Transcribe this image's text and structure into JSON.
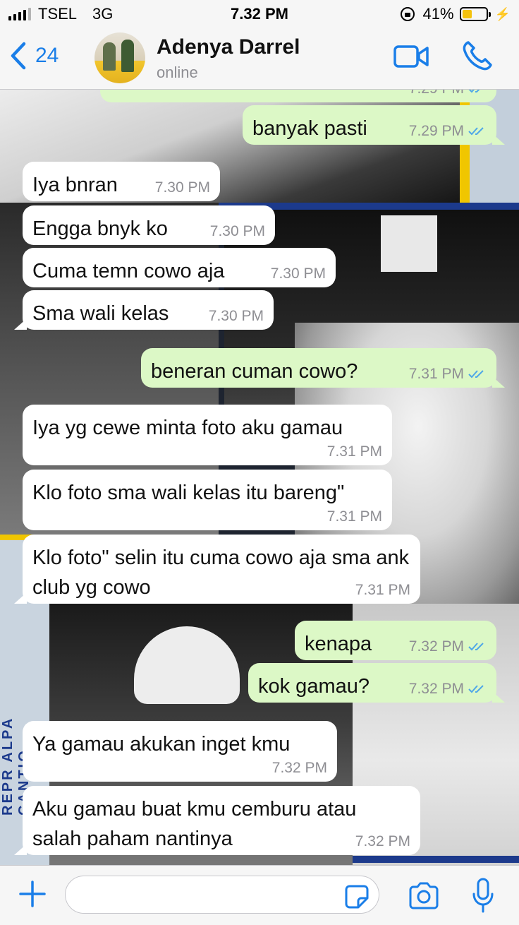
{
  "status_bar": {
    "carrier": "TSEL",
    "network": "3G",
    "time": "7.32 PM",
    "battery_percent": "41%",
    "battery_level": 0.41
  },
  "header": {
    "back_count": "24",
    "contact_name": "Adenya Darrel",
    "contact_status": "online",
    "accent_color": "#1a7ee8"
  },
  "wallpaper": {
    "side_text": "REPR ALPA CANTIQ"
  },
  "messages": [
    {
      "dir": "out",
      "text": "",
      "time": "7.29 PM",
      "ticks": "read"
    },
    {
      "dir": "out",
      "text": "banyak pasti",
      "time": "7.29 PM",
      "ticks": "read"
    },
    {
      "dir": "in",
      "text": "Iya bnran",
      "time": "7.30 PM"
    },
    {
      "dir": "in",
      "text": "Engga bnyk ko",
      "time": "7.30 PM"
    },
    {
      "dir": "in",
      "text": "Cuma temn cowo aja",
      "time": "7.30 PM"
    },
    {
      "dir": "in",
      "text": "Sma wali kelas",
      "time": "7.30 PM"
    },
    {
      "dir": "out",
      "text": "beneran cuman cowo?",
      "time": "7.31 PM",
      "ticks": "read"
    },
    {
      "dir": "in",
      "text": "Iya yg cewe minta foto aku gamau",
      "time": "7.31 PM"
    },
    {
      "dir": "in",
      "text": "Klo foto sma wali kelas itu bareng\"",
      "time": "7.31 PM"
    },
    {
      "dir": "in",
      "text": "Klo foto\" selin itu cuma cowo aja sma ank club yg cowo",
      "time": "7.31 PM"
    },
    {
      "dir": "out",
      "text": "kenapa",
      "time": "7.32 PM",
      "ticks": "read"
    },
    {
      "dir": "out",
      "text": "kok gamau?",
      "time": "7.32 PM",
      "ticks": "read"
    },
    {
      "dir": "in",
      "text": "Ya gamau akukan inget kmu",
      "time": "7.32 PM"
    },
    {
      "dir": "in",
      "text": "Aku gamau buat kmu cemburu atau salah paham nantinya",
      "time": "7.32 PM"
    }
  ],
  "input": {
    "value": "",
    "placeholder": ""
  },
  "colors": {
    "incoming_bubble": "#ffffff",
    "outgoing_bubble": "#dcf8c6",
    "read_ticks": "#4fa7e8"
  }
}
